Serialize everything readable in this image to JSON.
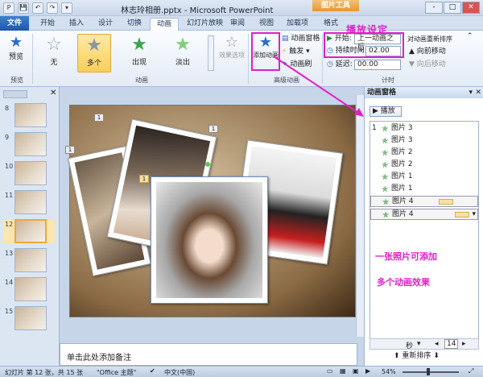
{
  "window": {
    "title": "林志玲相册.pptx - Microsoft PowerPoint",
    "contextual_tab": "图片工具",
    "controls": [
      "-",
      "□",
      "✕"
    ]
  },
  "qat": [
    "P",
    "💾",
    "↶",
    "↷",
    "▾"
  ],
  "tabs": {
    "file": "文件",
    "items": [
      "开始",
      "插入",
      "设计",
      "切换",
      "动画",
      "幻灯片放映",
      "审阅",
      "视图",
      "加载项",
      "格式"
    ],
    "active": "动画"
  },
  "ribbon": {
    "preview": {
      "label": "预览",
      "group": "预览"
    },
    "effects": [
      {
        "label": "无",
        "icon": "no-effect-star-icon"
      },
      {
        "label": "多个",
        "icon": "multi-effect-star-icon"
      },
      {
        "label": "出现",
        "icon": "appear-star-icon"
      },
      {
        "label": "淡出",
        "icon": "fade-star-icon"
      }
    ],
    "effect_options": "效果选项",
    "animation_group": "动画",
    "add_animation": "添加动画",
    "anim_pane": "动画窗格",
    "trigger": "触发",
    "anim_painter": "动画刷",
    "advanced_group": "高级动画",
    "start_label": "开始:",
    "start_value": "上一动画之后",
    "duration_label": "持续时间:",
    "duration_value": "02.00",
    "delay_label": "延迟:",
    "delay_value": "00.00",
    "reorder_title": "对动画重新排序",
    "move_earlier": "向前移动",
    "move_later": "向后移动",
    "timing_group": "计时"
  },
  "annotations": {
    "play_setting": "播放设定",
    "note1": "一张照片可添加",
    "note2": "多个动画效果"
  },
  "thumbnails": [
    "8",
    "9",
    "10",
    "11",
    "12",
    "13",
    "14",
    "15"
  ],
  "slide_tags": [
    "1",
    "1",
    "1",
    "1"
  ],
  "notes_placeholder": "单击此处添加备注",
  "anim_pane": {
    "title": "动画窗格",
    "play": "播放",
    "items": [
      {
        "num": "1",
        "label": "图片 3"
      },
      {
        "num": "",
        "label": "图片 3"
      },
      {
        "num": "",
        "label": "图片 2"
      },
      {
        "num": "",
        "label": "图片 2"
      },
      {
        "num": "",
        "label": "图片 1"
      },
      {
        "num": "",
        "label": "图片 1"
      },
      {
        "num": "",
        "label": "图片 4"
      },
      {
        "num": "",
        "label": "图片 4"
      }
    ],
    "seconds": "秒",
    "page": "14",
    "reorder": "重新排序"
  },
  "status": {
    "slide_info": "幻灯片 第 12 张，共 15 张",
    "theme": "\"Office 主题\"",
    "lang": "中文(中国)",
    "zoom": "54%"
  }
}
